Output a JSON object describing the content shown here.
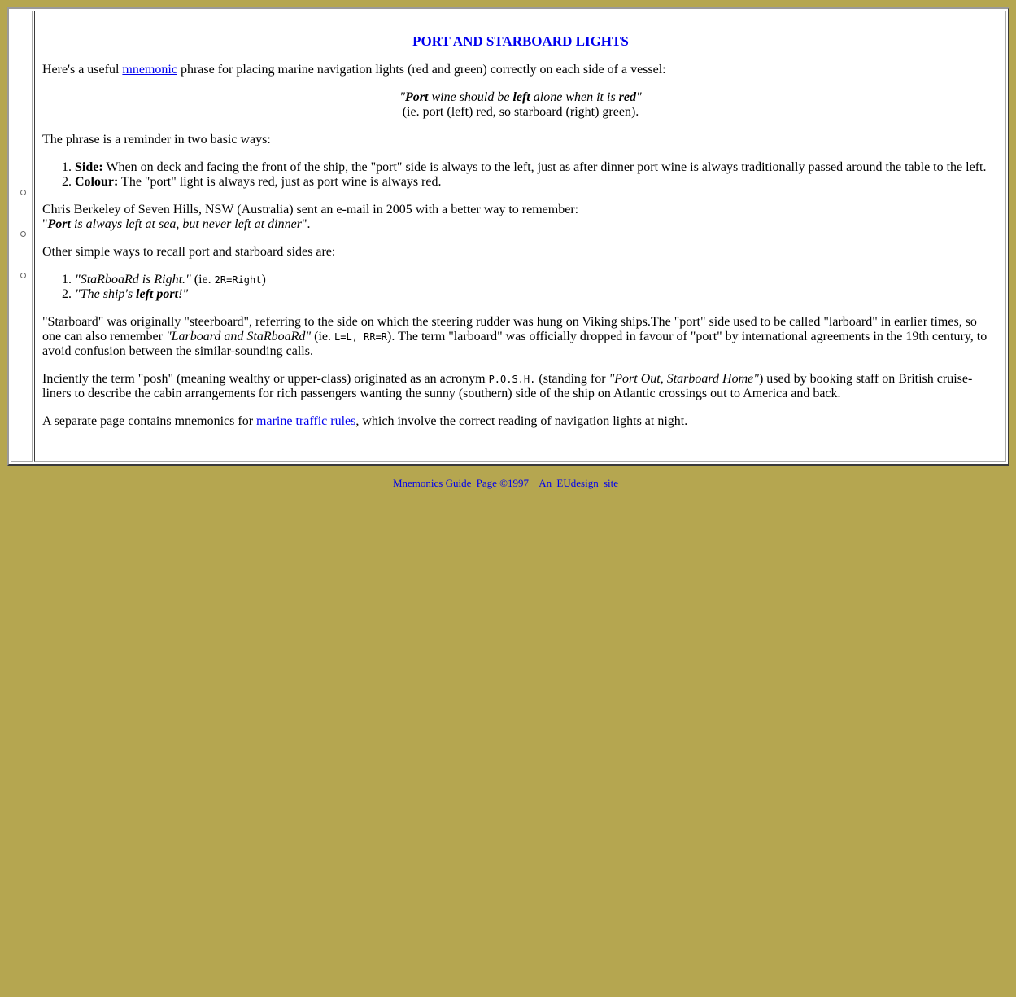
{
  "page": {
    "title": "PORT AND STARBOARD LIGHTS",
    "intro": {
      "before": "Here's a useful ",
      "link": "mnemonic",
      "after": " phrase for placing marine navigation lights (red and green) correctly on each side of a vessel:"
    },
    "quote": {
      "open_quote": "\"",
      "word1": "Port",
      "mid1": " wine should be ",
      "word2": "left",
      "mid2": " alone when it is ",
      "word3": "red",
      "close_quote": "\"",
      "note": "(ie. port (left) red, so starboard (right) green)."
    },
    "reminder_intro": "The phrase is a reminder in two basic ways:",
    "ways": [
      {
        "label": "Side:",
        "text": " When on deck and facing the front of the ship, the \"port\" side is always to the left, just as after dinner port wine is always traditionally passed around the table to the left."
      },
      {
        "label": "Colour:",
        "text": " The \"port\" light is always red, just as port wine is always red."
      }
    ],
    "chris": {
      "line1": "Chris Berkeley of Seven Hills, NSW (Australia) sent an e-mail in 2005 with a better way to remember:",
      "q_open": "\"",
      "bold": "Port",
      "rest": " is always left at sea, but never left at dinner",
      "q_close": "\"."
    },
    "other_intro": "Other simple ways to recall port and starboard sides are:",
    "other_ways": {
      "item1": {
        "text": "\"StaRboaRd is Right.\"",
        "mid": " (ie. ",
        "code": "2R=Right",
        "end": ")"
      },
      "item2": {
        "before": "\"The ship's ",
        "bold": "left port",
        "after": "!\""
      }
    },
    "starboard_para": {
      "before": "\"Starboard\" was originally \"steerboard\", referring to the side on which the steering rudder was hung on Viking ships.The \"port\" side used to be called \"larboard\" in earlier times, so one can also remember ",
      "italic": "\"Larboard and StaRboaRd\"",
      "mid": " (ie. ",
      "code": "L=L, RR=R",
      "after": "). The term \"larboard\" was officially dropped in favour of \"port\" by international agreements in the 19th century, to avoid confusion between the similar-sounding calls."
    },
    "posh_para": {
      "before": "Inciently the term \"posh\" (meaning wealthy or upper-class) originated as an acronym ",
      "code": "P.O.S.H.",
      "mid": " (standing for ",
      "italic": "\"Port Out, Starboard Home\"",
      "after": ") used by booking staff on British cruise-liners to describe the cabin arrangements for rich passengers wanting the sunny (southern) side of the ship on Atlantic crossings out to America and back."
    },
    "separate": {
      "before": "A separate page contains mnemonics for ",
      "link": "marine traffic rules",
      "after": ", which involve the correct reading of navigation lights at night."
    }
  },
  "footer": {
    "guide_link": "Mnemonics Guide",
    "copyright": "Page ©1997",
    "an": "An",
    "site_link": "EUdesign",
    "site": "site"
  },
  "colors": {
    "background": "#b5a650",
    "heading": "#0000ee",
    "link": "#0000ee"
  },
  "icons": [
    "binder-hole-icon",
    "binder-hole-icon",
    "binder-hole-icon"
  ]
}
